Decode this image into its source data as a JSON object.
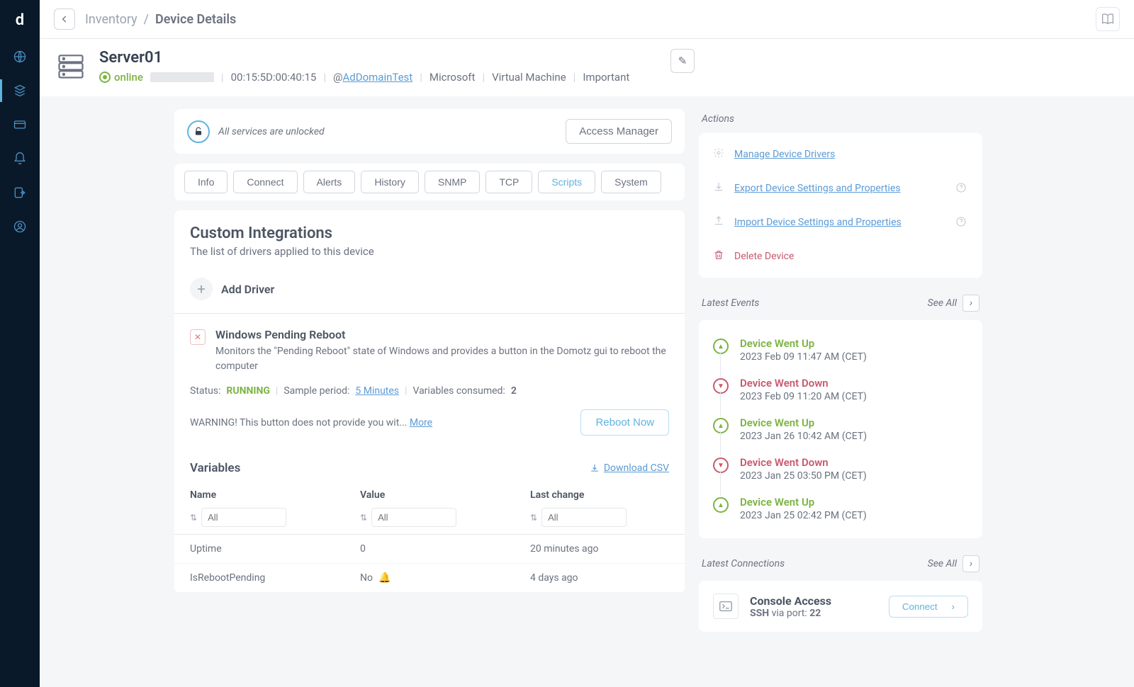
{
  "breadcrumb": {
    "parent": "Inventory",
    "current": "Device Details"
  },
  "device": {
    "name": "Server01",
    "status": "online",
    "mac": "00:15:5D:00:40:15",
    "domain_prefix": "@",
    "domain": "AdDomainTest",
    "vendor": "Microsoft",
    "type": "Virtual Machine",
    "importance": "Important"
  },
  "services": {
    "unlocked_text": "All services are unlocked",
    "access_manager": "Access Manager"
  },
  "tabs": [
    "Info",
    "Connect",
    "Alerts",
    "History",
    "SNMP",
    "TCP",
    "Scripts",
    "System"
  ],
  "active_tab": "Scripts",
  "integrations": {
    "title": "Custom Integrations",
    "subtitle": "The list of drivers applied to this device",
    "add_label": "Add Driver"
  },
  "driver": {
    "title": "Windows Pending Reboot",
    "desc": "Monitors the \"Pending Reboot\" state of Windows and provides a button in the Domotz gui to reboot the computer",
    "status_label": "Status:",
    "status_value": "RUNNING",
    "period_label": "Sample period:",
    "period_value": "5 Minutes",
    "vars_label": "Variables consumed:",
    "vars_value": "2",
    "warning": "WARNING! This button does not provide you wit...",
    "more": "More",
    "reboot_btn": "Reboot Now"
  },
  "variables": {
    "title": "Variables",
    "download": "Download CSV",
    "cols": {
      "name": "Name",
      "value": "Value",
      "last": "Last change"
    },
    "filter_placeholder": "All",
    "rows": [
      {
        "name": "Uptime",
        "value": "0",
        "last": "20 minutes ago",
        "bell": false
      },
      {
        "name": "IsRebootPending",
        "value": "No",
        "last": "4 days ago",
        "bell": true
      }
    ]
  },
  "actions": {
    "title": "Actions",
    "items": {
      "manage": "Manage Device Drivers",
      "export": "Export Device Settings and Properties",
      "import": "Import Device Settings and Properties",
      "delete": "Delete Device"
    }
  },
  "events": {
    "title": "Latest Events",
    "see_all": "See All",
    "list": [
      {
        "dir": "up",
        "title": "Device Went Up",
        "time": "2023 Feb 09 11:47 AM (CET)"
      },
      {
        "dir": "down",
        "title": "Device Went Down",
        "time": "2023 Feb 09 11:20 AM (CET)"
      },
      {
        "dir": "up",
        "title": "Device Went Up",
        "time": "2023 Jan 26 10:42 AM (CET)"
      },
      {
        "dir": "down",
        "title": "Device Went Down",
        "time": "2023 Jan 25 03:50 PM (CET)"
      },
      {
        "dir": "up",
        "title": "Device Went Up",
        "time": "2023 Jan 25 02:42 PM (CET)"
      }
    ]
  },
  "connections": {
    "title": "Latest Connections",
    "see_all": "See All",
    "card": {
      "title": "Console Access",
      "proto": "SSH",
      "via": " via port: ",
      "port": "22",
      "btn": "Connect"
    }
  }
}
